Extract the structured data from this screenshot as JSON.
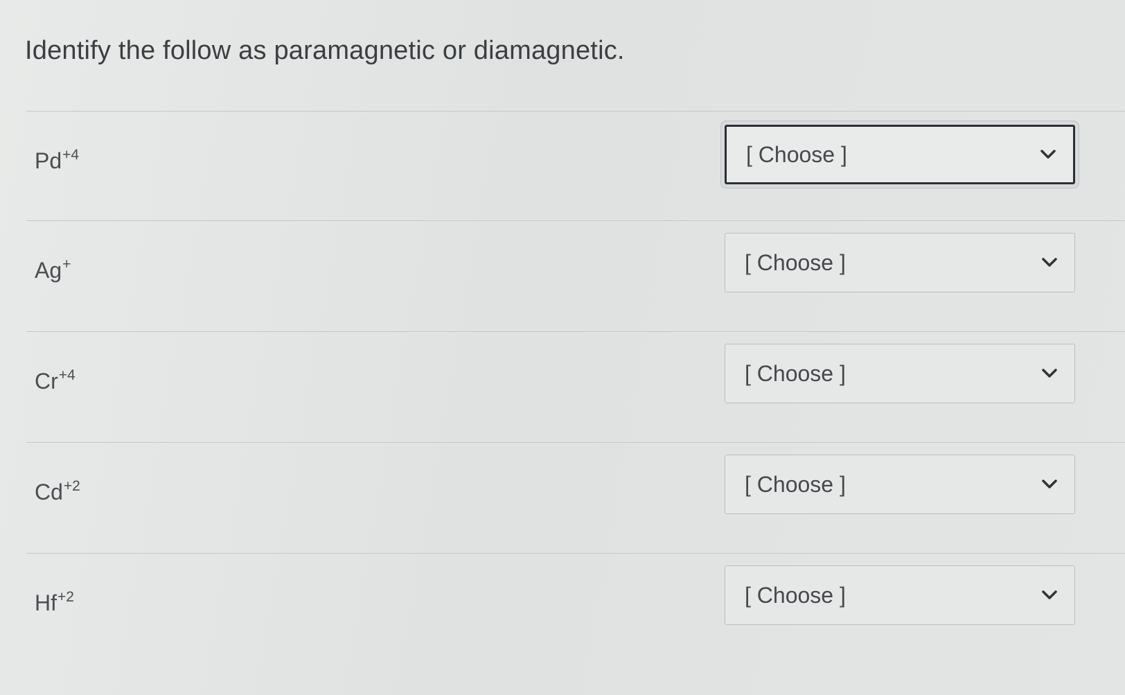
{
  "question": {
    "text": "Identify the follow as paramagnetic or diamagnetic."
  },
  "rows": [
    {
      "ion": "Pd",
      "charge": "+4",
      "selected": "[ Choose ]"
    },
    {
      "ion": "Ag",
      "charge": "+",
      "selected": "[ Choose ]"
    },
    {
      "ion": "Cr",
      "charge": "+4",
      "selected": "[ Choose ]"
    },
    {
      "ion": "Cd",
      "charge": "+2",
      "selected": "[ Choose ]"
    },
    {
      "ion": "Hf",
      "charge": "+2",
      "selected": "[ Choose ]"
    }
  ],
  "icons": {
    "dropdown": "chevron-down-icon"
  },
  "colors": {
    "background": "#e4e6e5",
    "text": "#3b3e42",
    "focus_border": "#2b2e33",
    "box_border": "#b9bdbf"
  }
}
